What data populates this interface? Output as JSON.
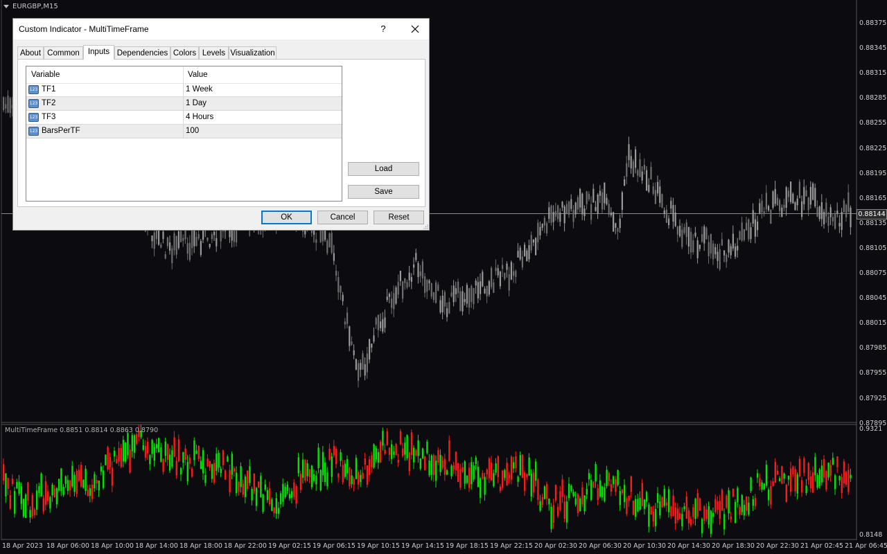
{
  "chart": {
    "symbol_label": "EURGBP,M15",
    "indicator_label": "MultiTimeFrame 0.8851 0.8814 0.8863 0.8790",
    "current_price": "0.88144",
    "price_ticks": [
      "0.88375",
      "0.88345",
      "0.88315",
      "0.88285",
      "0.88255",
      "0.88225",
      "0.88195",
      "0.88165",
      "0.88135",
      "0.88105",
      "0.88075",
      "0.88045",
      "0.88015",
      "0.87985",
      "0.87955",
      "0.87925",
      "0.87895"
    ],
    "indicator_ticks": [
      "0.9321",
      "0.8148"
    ],
    "time_ticks": [
      "18 Apr 2023",
      "18 Apr 06:00",
      "18 Apr 10:00",
      "18 Apr 14:00",
      "18 Apr 18:00",
      "18 Apr 22:00",
      "19 Apr 02:15",
      "19 Apr 06:15",
      "19 Apr 10:15",
      "19 Apr 14:15",
      "19 Apr 18:15",
      "19 Apr 22:15",
      "20 Apr 02:30",
      "20 Apr 06:30",
      "20 Apr 10:30",
      "20 Apr 14:30",
      "20 Apr 18:30",
      "20 Apr 22:30",
      "21 Apr 02:45",
      "21 Apr 06:45"
    ],
    "colors": {
      "background": "#0c0c10",
      "candle": "#8c8c8c",
      "bull": "#00e600",
      "bear": "#ff1a1a"
    }
  },
  "dialog": {
    "title": "Custom Indicator - MultiTimeFrame",
    "help_label": "?",
    "tabs": [
      {
        "label": "About"
      },
      {
        "label": "Common"
      },
      {
        "label": "Inputs",
        "active": true
      },
      {
        "label": "Dependencies"
      },
      {
        "label": "Colors"
      },
      {
        "label": "Levels"
      },
      {
        "label": "Visualization"
      }
    ],
    "columns": {
      "variable": "Variable",
      "value": "Value"
    },
    "rows": [
      {
        "icon": "123",
        "variable": "TF1",
        "value": "1 Week"
      },
      {
        "icon": "123",
        "variable": "TF2",
        "value": "1 Day"
      },
      {
        "icon": "123",
        "variable": "TF3",
        "value": "4 Hours"
      },
      {
        "icon": "123",
        "variable": "BarsPerTF",
        "value": "100"
      }
    ],
    "load_label": "Load",
    "save_label": "Save",
    "ok_label": "OK",
    "cancel_label": "Cancel",
    "reset_label": "Reset"
  }
}
